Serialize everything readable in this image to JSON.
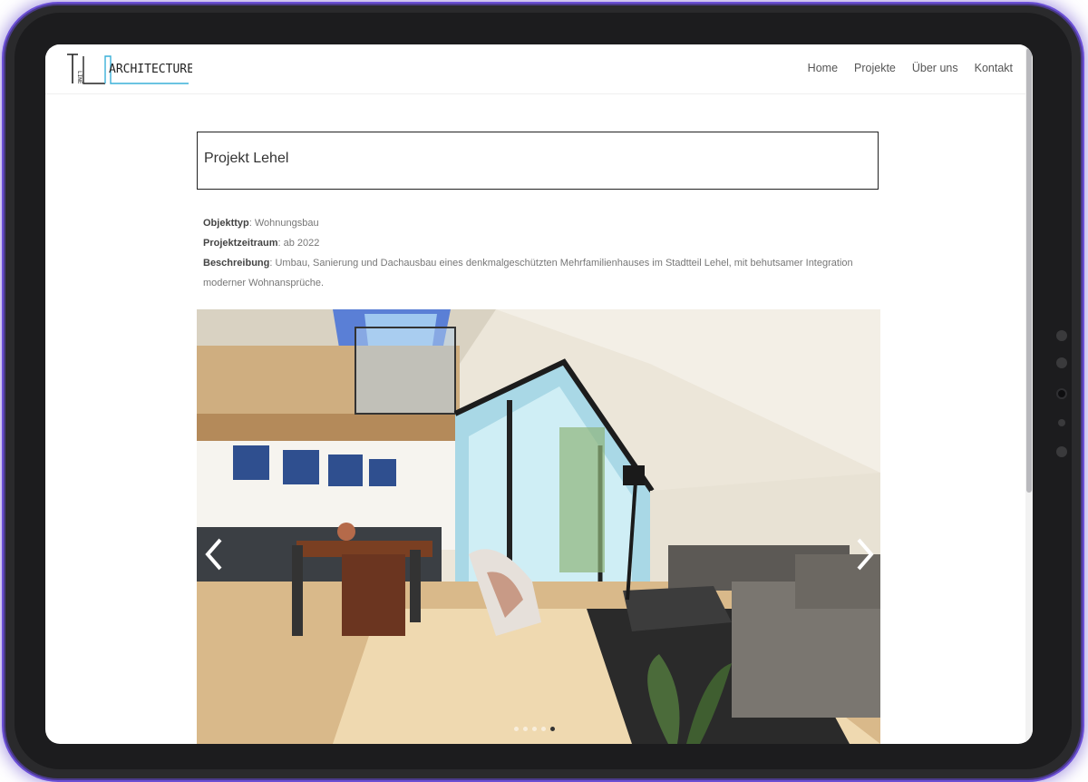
{
  "brand": {
    "logo_prefix": "LINE",
    "logo_text": "ARCHITECTURE"
  },
  "nav": [
    {
      "label": "Home"
    },
    {
      "label": "Projekte"
    },
    {
      "label": "Über uns"
    },
    {
      "label": "Kontakt"
    }
  ],
  "project": {
    "title": "Projekt Lehel",
    "fields": [
      {
        "label": "Objekttyp",
        "value": ": Wohnungsbau"
      },
      {
        "label": "Projektzeitraum",
        "value": ": ab 2022"
      },
      {
        "label": "Beschreibung",
        "value": ": Umbau, Sanierung und Dachausbau eines denkmalgeschützten Mehrfamilienhauses im Stadtteil Lehel, mit behutsamer Integration moderner Wohnansprüche."
      }
    ]
  },
  "slider": {
    "image_description_icon": "attic-living-room-render",
    "total_slides": 5,
    "active_slide": 5
  },
  "colors": {
    "logo_accent": "#3ab0d8",
    "frame_glow": "#6b4fd6"
  }
}
